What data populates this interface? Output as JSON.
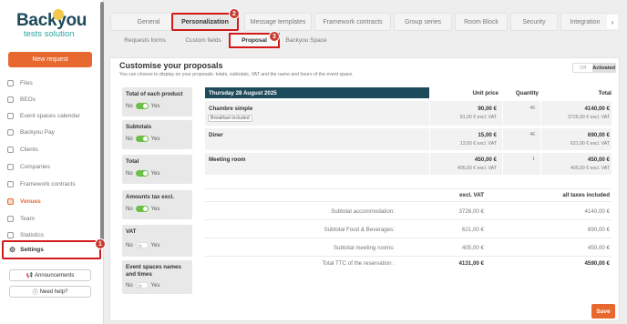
{
  "brand": {
    "name": "Backyou",
    "tagline": "tests solution"
  },
  "sidebar": {
    "new_request": "New request",
    "items": [
      {
        "label": "Files",
        "icon": "folder-icon"
      },
      {
        "label": "BEOs",
        "icon": "document-icon"
      },
      {
        "label": "Event spaces calendar",
        "icon": "calendar-icon"
      },
      {
        "label": "Backyou Pay",
        "icon": "card-icon"
      },
      {
        "label": "Clients",
        "icon": "user-icon"
      },
      {
        "label": "Companies",
        "icon": "building-icon"
      },
      {
        "label": "Framework contracts",
        "icon": "contract-icon"
      },
      {
        "label": "Venues",
        "icon": "venue-icon"
      },
      {
        "label": "Team",
        "icon": "team-icon"
      },
      {
        "label": "Statistics",
        "icon": "chart-icon"
      }
    ],
    "settings": "Settings",
    "announcements": "Announcements",
    "help": "Need help?"
  },
  "tabs": [
    "General",
    "Personalization",
    "Message templates",
    "Framework contracts",
    "Group series",
    "Room Block",
    "Security",
    "Integration"
  ],
  "subtabs": [
    "Requests forms",
    "Custom fields",
    "Proposal",
    "Backyou Space"
  ],
  "steps": {
    "s1": "1",
    "s2": "2",
    "s3": "3"
  },
  "proposal": {
    "title": "Customise your proposals",
    "subtitle": "You can choose to display on your proposals: totals, subtotals, VAT and the name and hours of the event space.",
    "toggle": {
      "off": "Off",
      "on": "Activated"
    },
    "options": [
      {
        "label": "Total of each product",
        "no": "No",
        "yes": "Yes",
        "state": "on"
      },
      {
        "label": "Subtotals",
        "no": "No",
        "yes": "Yes",
        "state": "on"
      },
      {
        "label": "Total",
        "no": "No",
        "yes": "Yes",
        "state": "on"
      },
      {
        "label": "Amounts tax excl.",
        "no": "No",
        "yes": "Yes",
        "state": "on"
      },
      {
        "label": "VAT",
        "no": "No",
        "yes": "Yes",
        "state": "off"
      },
      {
        "label": "Event spaces names and times",
        "no": "No",
        "yes": "Yes",
        "state": "off"
      }
    ],
    "table": {
      "date": "Thursday 28 August 2025",
      "headers": {
        "unit_price": "Unit price",
        "quantity": "Quantity",
        "total": "Total"
      },
      "rows": [
        {
          "name": "Chambre simple",
          "tag": "Breakfast included",
          "price": "90,00 €",
          "price_ex": "81,00 € excl. VAT",
          "qty": "46",
          "total": "4140,00 €",
          "total_ex": "3726,00 € excl. VAT"
        },
        {
          "name": "Diner",
          "price": "15,00 €",
          "price_ex": "13,50 € excl. VAT",
          "qty": "46",
          "total": "690,00 €",
          "total_ex": "621,00 € excl. VAT"
        },
        {
          "name": "Meeting room",
          "price": "450,00 €",
          "price_ex": "405,00 € excl. VAT",
          "qty": "1",
          "total": "450,00 €",
          "total_ex": "405,00 € excl. VAT"
        }
      ]
    },
    "summary": {
      "h_excl": "excl. VAT",
      "h_incl": "all taxes included",
      "lines": [
        {
          "label": "Subtotal accommodation:",
          "excl": "3726,00 €",
          "incl": "4140,00 €"
        },
        {
          "label": "Subtotal Food & Beverages:",
          "excl": "621,00 €",
          "incl": "690,00 €"
        },
        {
          "label": "Subtotal meeting rooms:",
          "excl": "405,00 €",
          "incl": "450,00 €"
        },
        {
          "label": "Total TTC of the reservation :",
          "excl": "4131,00 €",
          "incl": "4590,00 €"
        }
      ]
    },
    "save": "Save"
  }
}
